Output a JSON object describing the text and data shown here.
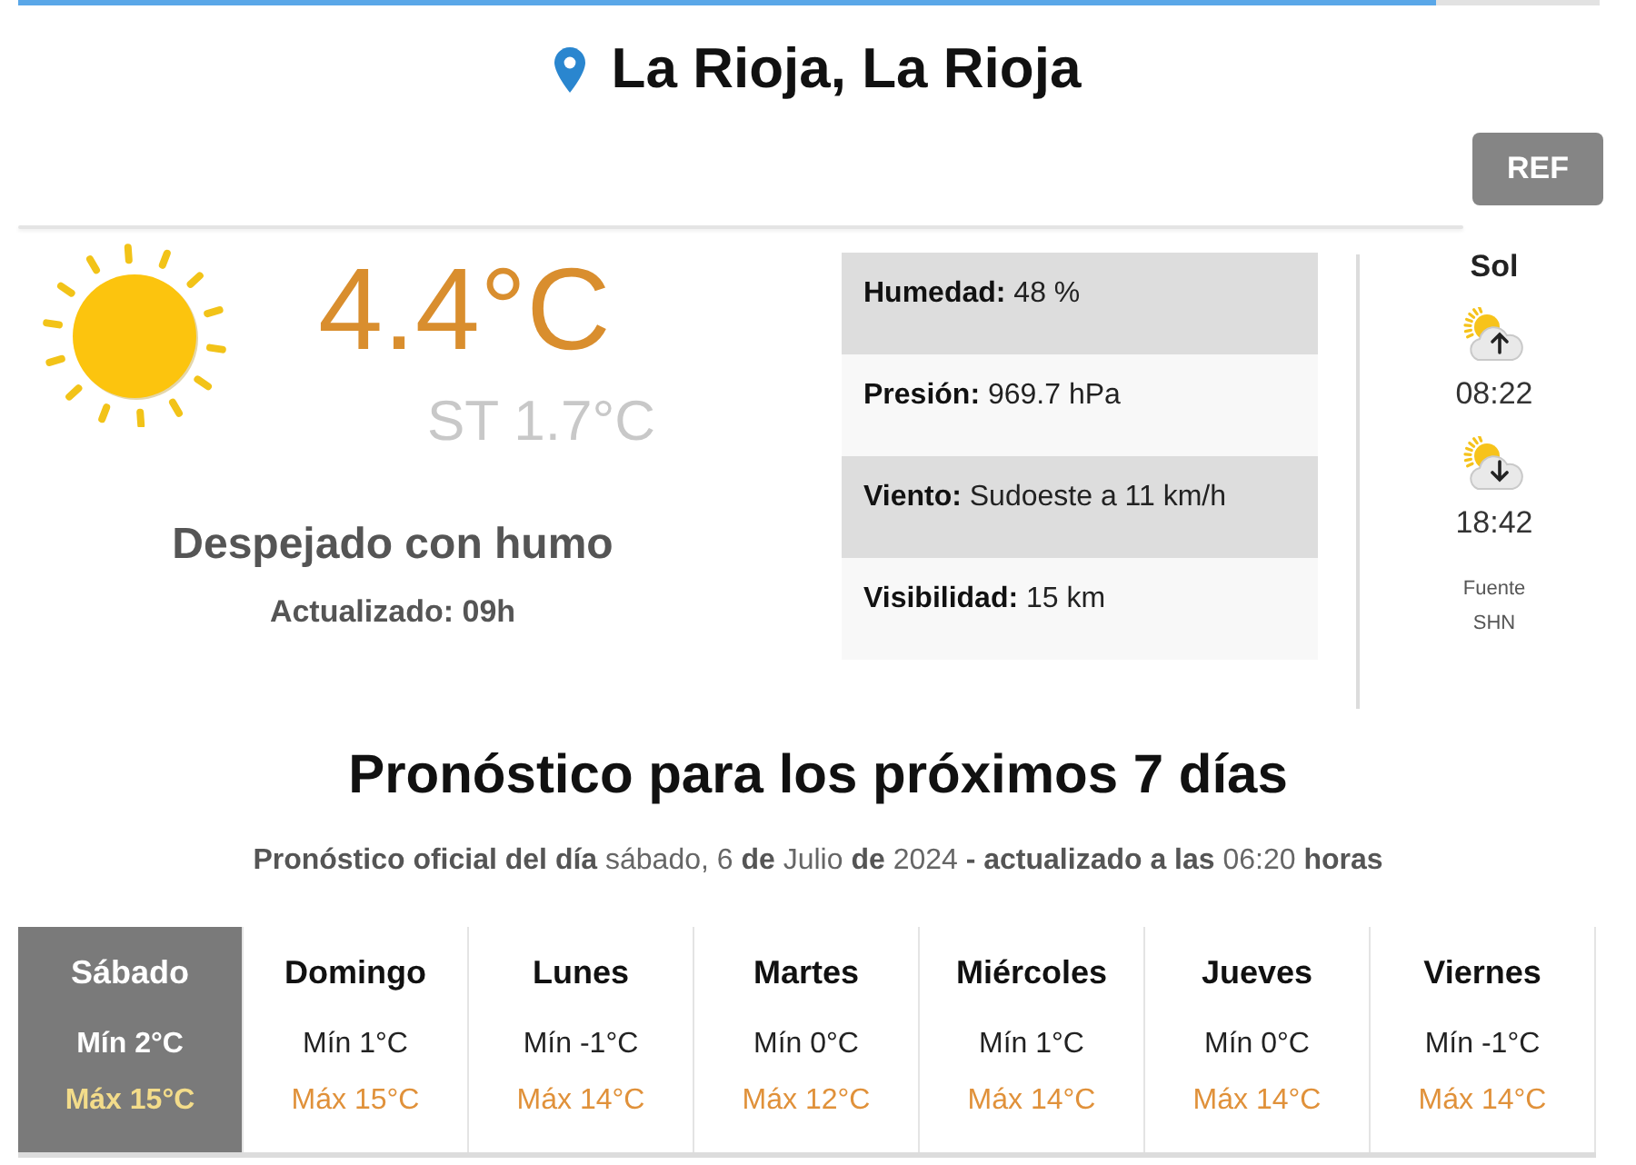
{
  "header": {
    "title": "La Rioja, La Rioja",
    "ref_button": "REF"
  },
  "current": {
    "temperature": "4.4°C",
    "feels_like": "ST 1.7°C",
    "condition": "Despejado con humo",
    "updated": "Actualizado: 09h"
  },
  "details": [
    "**Humedad:** 48 %",
    "**Presión:** 969.7 hPa",
    "**Viento:** Sudoeste a 11 km/h",
    "**Visibilidad:** 15 km"
  ],
  "sun": {
    "title": "Sol",
    "events": [
      {
        "kind": "sunrise",
        "time": "08:22"
      },
      {
        "kind": "sunset",
        "time": "18:42"
      }
    ],
    "source": [
      "Fuente",
      "SHN"
    ]
  },
  "forecast": {
    "title": "Pronóstico para los próximos 7 días",
    "subtitle": "**Pronóstico oficial del día** sábado, 6 **de** Julio **de** 2024 **- actualizado a las** 06:20 **horas**",
    "days": [
      {
        "day": "Sábado",
        "min": "Mín 2°C",
        "max": "Máx 15°C",
        "selected": true
      },
      {
        "day": "Domingo",
        "min": "Mín 1°C",
        "max": "Máx 15°C",
        "selected": false
      },
      {
        "day": "Lunes",
        "min": "Mín -1°C",
        "max": "Máx 14°C",
        "selected": false
      },
      {
        "day": "Martes",
        "min": "Mín 0°C",
        "max": "Máx 12°C",
        "selected": false
      },
      {
        "day": "Miércoles",
        "min": "Mín 1°C",
        "max": "Máx 14°C",
        "selected": false
      },
      {
        "day": "Jueves",
        "min": "Mín 0°C",
        "max": "Máx 14°C",
        "selected": false
      },
      {
        "day": "Viernes",
        "min": "Mín -1°C",
        "max": "Máx 14°C",
        "selected": false
      }
    ]
  }
}
